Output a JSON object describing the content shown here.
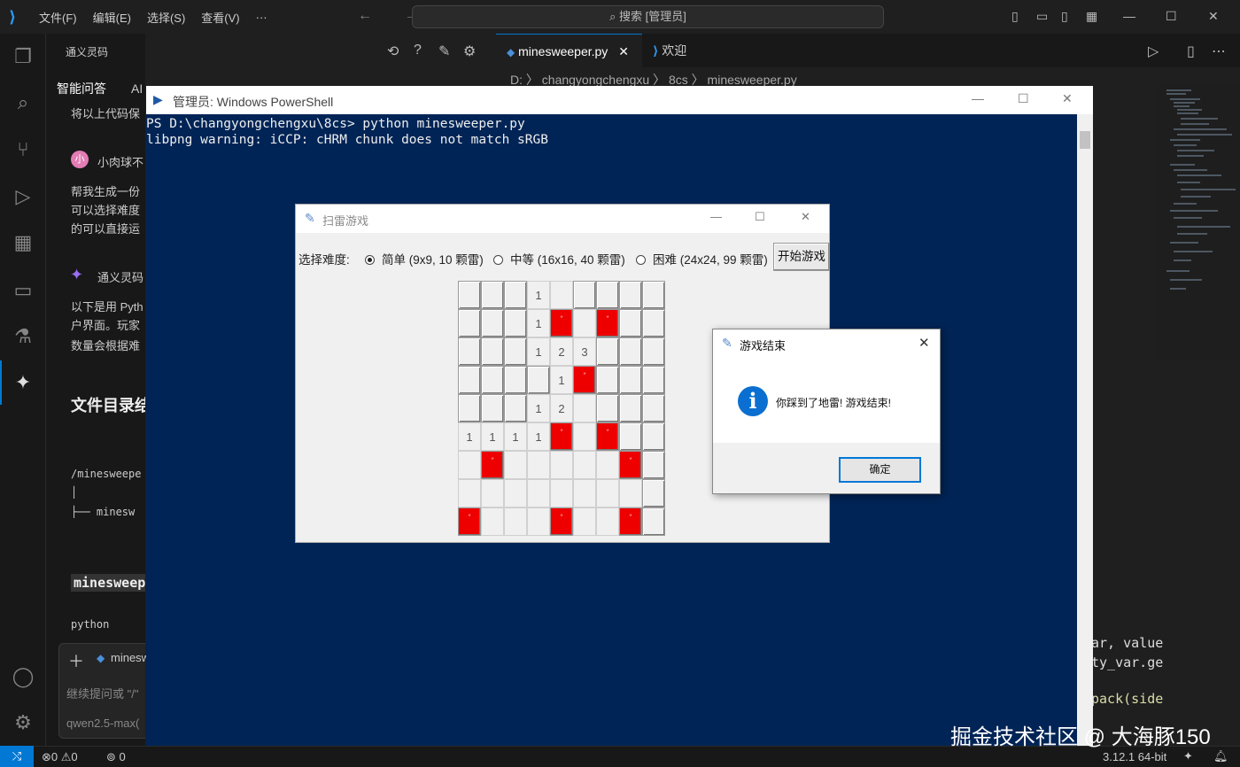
{
  "titlebar": {
    "menus": [
      "文件(F)",
      "编辑(E)",
      "选择(S)",
      "查看(V)",
      "···"
    ],
    "search": "搜索 [管理员]",
    "arrows": "← →"
  },
  "sidepanel": {
    "header": "通义灵码",
    "tabs": [
      "智能问答",
      "AI 程序员"
    ],
    "user_pill": "小肉球不吃肉",
    "lines": {
      "top": "将以上代码保",
      "user_name": "小肉球不",
      "user_avatar": "小",
      "req1": "帮我生成一份",
      "req2": "可以选择难度",
      "req3": "的可以直接运",
      "bot_name": "通义灵码",
      "ans1": "以下是用 Pyth",
      "ans2": "户界面。玩家",
      "ans3": "数量会根据难",
      "heading": "文件目录结",
      "tree1": "/minesweepe",
      "tree2": "│",
      "tree3": "├── minesw",
      "code_heading": "minesweep",
      "lang": "python",
      "file_chip": "minesw",
      "placeholder": "继续提问或 \"/\"",
      "model": "qwen2.5-max("
    }
  },
  "editor": {
    "tabs": [
      {
        "label": "minesweeper.py",
        "close": "✕"
      },
      {
        "label": "欢迎"
      }
    ],
    "breadcrumb": "D: 〉 changyongchengxu 〉 8cs 〉 minesweeper.py",
    "code_lines": [
      "ar, value",
      "ty_var.ge",
      "pack(side"
    ]
  },
  "powershell": {
    "title": "管理员: Windows PowerShell",
    "lines": [
      "PS D:\\changyongchengxu\\8cs> python minesweeper.py",
      "libpng warning: iCCP: cHRM chunk does not match sRGB"
    ]
  },
  "minesweeper": {
    "title": "扫雷游戏",
    "difficulty_label": "选择难度:",
    "options": [
      {
        "label": "简单 (9x9, 10 颗雷)",
        "selected": true
      },
      {
        "label": "中等 (16x16, 40 颗雷)",
        "selected": false
      },
      {
        "label": "困难 (24x24, 99 颗雷)",
        "selected": false
      }
    ],
    "start_button": "开始游戏",
    "mine_color": "#ee0000",
    "mine_mark": "*",
    "board": [
      [
        "r",
        "r",
        "r",
        "1",
        "f",
        "r",
        "r",
        "r",
        "r"
      ],
      [
        "r",
        "r",
        "r",
        "1",
        "m",
        "f",
        "m",
        "r",
        "r"
      ],
      [
        "r",
        "r",
        "r",
        "1",
        "2",
        "3",
        "r",
        "r",
        "r"
      ],
      [
        "r",
        "r",
        "r",
        "r",
        "1",
        "m",
        "r",
        "r",
        "r"
      ],
      [
        "r",
        "r",
        "r",
        "1",
        "2",
        "f",
        "r",
        "r",
        "r"
      ],
      [
        "1",
        "1",
        "1",
        "1",
        "m",
        "f",
        "m",
        "r",
        "r"
      ],
      [
        "f",
        "m",
        "f",
        "f",
        "f",
        "f",
        "f",
        "m",
        "r"
      ],
      [
        "f",
        "f",
        "f",
        "f",
        "f",
        "f",
        "f",
        "f",
        "r"
      ],
      [
        "m",
        "f",
        "f",
        "f",
        "m",
        "f",
        "f",
        "m",
        "r"
      ]
    ]
  },
  "dialog": {
    "title": "游戏结束",
    "message": "你踩到了地雷! 游戏结束!",
    "ok": "确定",
    "icon": "i"
  },
  "statusbar": {
    "errors": "0",
    "warnings": "0",
    "ports": "0",
    "python": "3.12.1 64-bit"
  },
  "watermark": "掘金技术社区 @ 大海豚150"
}
